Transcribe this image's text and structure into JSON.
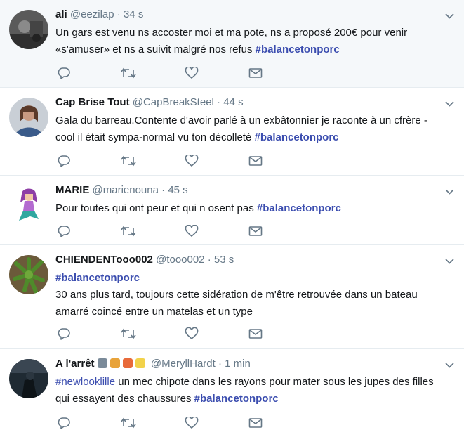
{
  "tweets": [
    {
      "name": "ali",
      "handle": "@eezilap",
      "separator": "·",
      "time": "34 s",
      "text": "Un gars est venu ns accoster moi et ma pote, ns a proposé 200€ pour venir «s'amuser» et ns a suivit malgré nos refus",
      "hashtag": "#balancetonporc"
    },
    {
      "name": "Cap Brise Tout",
      "handle": "@CapBreakSteel",
      "separator": "·",
      "time": "44 s",
      "text": "Gala du barreau.Contente d'avoir parlé à un exbâtonnier je raconte à un cfrère -cool il était sympa-normal vu ton décolleté",
      "hashtag": "#balancetonporc"
    },
    {
      "name": "MARIE",
      "handle": "@marienouna",
      "separator": "·",
      "time": "45 s",
      "text": "Pour toutes qui ont peur et qui n osent pas ",
      "hashtag": "#balancetonporc"
    },
    {
      "name": "CHIENDENTooo002",
      "handle": "@tooo002",
      "separator": "·",
      "time": "53 s",
      "hashtag": "#balancetonporc",
      "text": "30 ans plus tard, toujours cette sidération de m'être retrouvée dans un bateau amarré coincé entre un matelas et un type"
    },
    {
      "name": "A l'arrêt",
      "handle": "@MeryllHardt",
      "separator": "·",
      "time": "1 min",
      "lead_hashtag": "#newlooklille",
      "text": " un mec chipote dans les rayons pour mater sous les jupes des filles qui essayent des chaussures ",
      "hashtag": "#balancetonporc"
    }
  ],
  "icons": {
    "reply": "reply-icon",
    "retweet": "retweet-icon",
    "like": "like-icon",
    "dm": "direct-message-icon",
    "menu": "chevron-down-icon"
  },
  "colors": {
    "hashtag": "#3b4daf",
    "muted": "#657786",
    "highlight_bg": "#f5f8fa",
    "divider": "#e6ecf0"
  }
}
